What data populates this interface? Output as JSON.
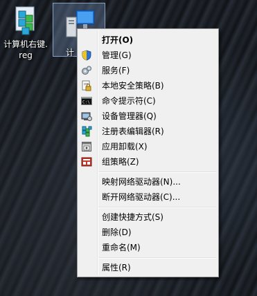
{
  "desktop": {
    "icons": [
      {
        "label": "计算机右键.reg",
        "line1": "计算机右键.",
        "line2": "reg"
      },
      {
        "label": "计"
      }
    ]
  },
  "context_menu": {
    "items": [
      {
        "label": "打开(O)",
        "icon": "none"
      },
      {
        "label": "管理(G)",
        "icon": "shield-icon"
      },
      {
        "label": "服务(F)",
        "icon": "services-icon"
      },
      {
        "label": "本地安全策略(B)",
        "icon": "security-policy-icon"
      },
      {
        "label": "命令提示符(C)",
        "icon": "cmd-icon"
      },
      {
        "label": "设备管理器(Q)",
        "icon": "device-manager-icon"
      },
      {
        "label": "注册表编辑器(R)",
        "icon": "regedit-icon"
      },
      {
        "label": "应用卸载(X)",
        "icon": "uninstall-icon"
      },
      {
        "label": "组策略(Z)",
        "icon": "group-policy-icon"
      },
      {
        "label": "映射网络驱动器(N)...",
        "icon": "none"
      },
      {
        "label": "断开网络驱动器(C)...",
        "icon": "none"
      },
      {
        "label": "创建快捷方式(S)",
        "icon": "none"
      },
      {
        "label": "删除(D)",
        "icon": "none"
      },
      {
        "label": "重命名(M)",
        "icon": "none"
      },
      {
        "label": "属性(R)",
        "icon": "none"
      }
    ]
  }
}
